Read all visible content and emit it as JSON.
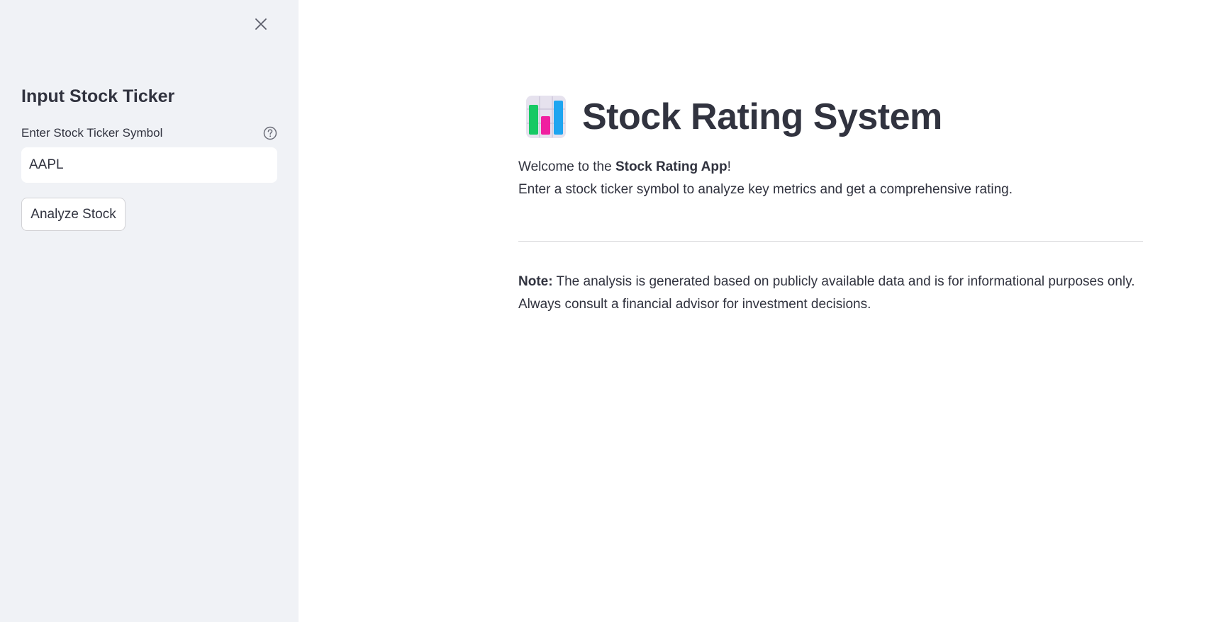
{
  "sidebar": {
    "close_icon": "close-icon",
    "heading": "Input Stock Ticker",
    "field_label": "Enter Stock Ticker Symbol",
    "help_icon": "question-circle-icon",
    "ticker_value": "AAPL",
    "analyze_label": "Analyze Stock"
  },
  "main": {
    "title_icon": "bar-chart-emoji-icon",
    "title": "Stock Rating System",
    "welcome_prefix": "Welcome to the ",
    "welcome_bold": "Stock Rating App",
    "welcome_suffix": "!",
    "intro_line2": "Enter a stock ticker symbol to analyze key metrics and get a comprehensive rating.",
    "note_label": "Note:",
    "note_text": " The analysis is generated based on publicly available data and is for informational purposes only.",
    "note_line2": "Always consult a financial advisor for investment decisions."
  },
  "colors": {
    "sidebar_bg": "#f0f2f6",
    "text": "#31333f",
    "bar_green": "#17c964",
    "bar_pink": "#f01fa0",
    "bar_blue": "#1ea5f0"
  }
}
